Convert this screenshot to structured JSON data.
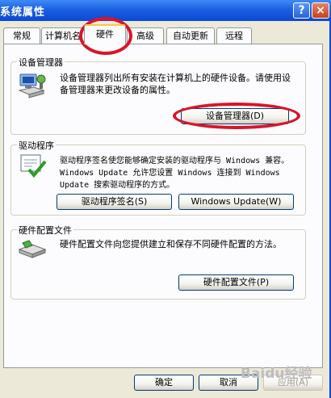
{
  "window": {
    "title": "系统属性",
    "help_label": "?",
    "close_label": "×"
  },
  "tabs": [
    {
      "label": "常规"
    },
    {
      "label": "计算机名"
    },
    {
      "label": "硬件"
    },
    {
      "label": "高级"
    },
    {
      "label": "自动更新"
    },
    {
      "label": "远程"
    }
  ],
  "device_manager": {
    "title": "设备管理器",
    "description": "设备管理器列出所有安装在计算机上的硬件设备。请使用设备管理器来更改设备的属性。",
    "button": "设备管理器(D)"
  },
  "drivers": {
    "title": "驱动程序",
    "description": "驱动程序签名使您能够确定安装的驱动程序与 Windows 兼容。Windows Update 允许您设置 Windows 连接到 Windows Update 搜索驱动程序的方式。",
    "signing_button": "驱动程序签名(S)",
    "update_button": "Windows Update(W)"
  },
  "hardware_profiles": {
    "title": "硬件配置文件",
    "description": "硬件配置文件向您提供建立和保存不同硬件配置的方法。",
    "button": "硬件配置文件(P)"
  },
  "footer": {
    "ok": "确定",
    "cancel": "取消",
    "apply": "应用(A)"
  },
  "watermark": "Baidu经验"
}
